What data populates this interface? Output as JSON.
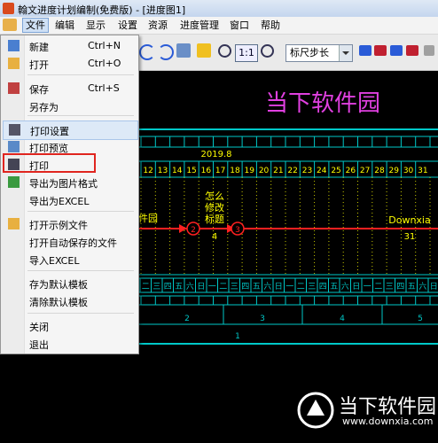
{
  "window": {
    "title": "翰文进度计划编制(免费版) - [进度图1]"
  },
  "menubar": {
    "items": [
      "文件",
      "编辑",
      "显示",
      "设置",
      "资源",
      "进度管理",
      "窗口",
      "帮助"
    ]
  },
  "toolbar": {
    "zoom_label": "1:1",
    "scale_select_value": "标尺步长"
  },
  "file_menu": {
    "items": [
      {
        "label": "新建",
        "shortcut": "Ctrl+N",
        "icon": "new-file-icon"
      },
      {
        "label": "打开",
        "shortcut": "Ctrl+O",
        "icon": "open-folder-icon"
      },
      {
        "label": "保存",
        "shortcut": "Ctrl+S",
        "icon": "save-icon"
      },
      {
        "label": "另存为",
        "shortcut": "",
        "icon": ""
      },
      {
        "label": "打印设置",
        "shortcut": "",
        "icon": "print-setup-icon"
      },
      {
        "label": "打印预览",
        "shortcut": "",
        "icon": "print-preview-icon"
      },
      {
        "label": "打印",
        "shortcut": "",
        "icon": "printer-icon"
      },
      {
        "label": "导出为图片格式",
        "shortcut": "",
        "icon": "export-image-icon"
      },
      {
        "label": "导出为EXCEL",
        "shortcut": "",
        "icon": ""
      },
      {
        "label": "打开示例文件",
        "shortcut": "",
        "icon": "open-folder-icon"
      },
      {
        "label": "打开自动保存的文件",
        "shortcut": "",
        "icon": ""
      },
      {
        "label": "导入EXCEL",
        "shortcut": "",
        "icon": ""
      },
      {
        "label": "存为默认模板",
        "shortcut": "",
        "icon": ""
      },
      {
        "label": "清除默认模板",
        "shortcut": "",
        "icon": ""
      },
      {
        "label": "关闭",
        "shortcut": "",
        "icon": ""
      },
      {
        "label": "退出",
        "shortcut": "",
        "icon": ""
      }
    ],
    "highlighted_item": "打印设置"
  },
  "canvas": {
    "chart_title": "当下软件园",
    "date_label": "2019.8",
    "day_numbers": [
      "12",
      "13",
      "14",
      "15",
      "16",
      "17",
      "18",
      "19",
      "20",
      "21",
      "22",
      "23",
      "24",
      "25",
      "26",
      "27",
      "28",
      "29",
      "30",
      "31"
    ],
    "task_left_label": "件园",
    "task_middle_label": "怎么\n修改\n标题",
    "task_middle_number": "4",
    "task_right_label": "Downxia",
    "task_right_number": "31",
    "node_2": "2",
    "node_3": "3",
    "weekdays": [
      "二",
      "三",
      "四",
      "五",
      "六",
      "日",
      "一",
      "二",
      "三",
      "四",
      "五",
      "六",
      "日",
      "一",
      "二",
      "三",
      "四",
      "五",
      "六",
      "日",
      "一",
      "二",
      "三",
      "四",
      "五",
      "六",
      "日"
    ],
    "week_numbers": [
      "2",
      "3",
      "4",
      "5"
    ],
    "month_number": "1",
    "colors": {
      "background": "#000000",
      "title": "#e040e0",
      "grid": "#00c8c8",
      "text": "#ffff00",
      "arrow": "#ff2020"
    }
  },
  "watermark": {
    "text": "当下软件园",
    "url": "www.downxia.com"
  }
}
